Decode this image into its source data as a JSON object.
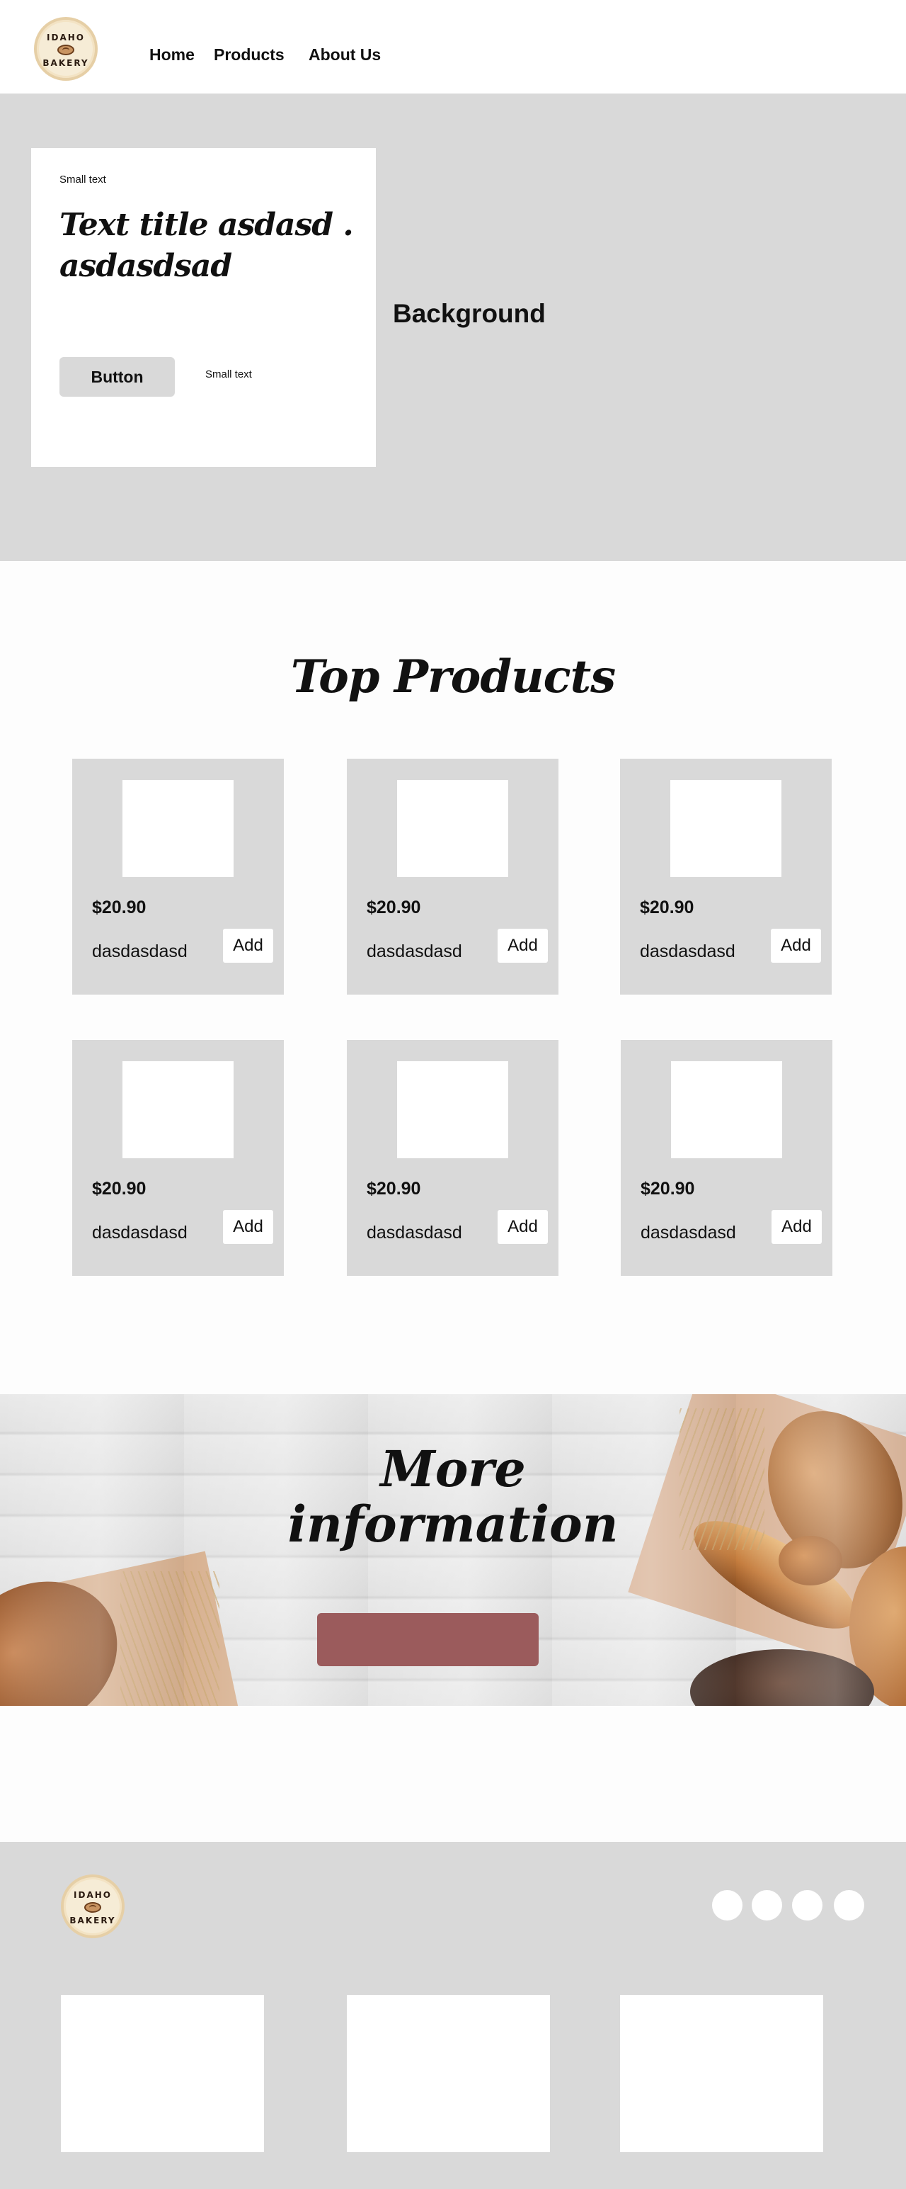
{
  "brand": {
    "logo_top_text": "IDAHO",
    "logo_bottom_text": "BAKERY"
  },
  "nav": {
    "items": [
      {
        "label": "Home"
      },
      {
        "label": "Products"
      },
      {
        "label": "About Us"
      }
    ]
  },
  "hero": {
    "small_text": "Small text",
    "title": "Text title asdasd . asdasdsad",
    "button_label": "Button",
    "button_small_text": "Small text",
    "background_label": "Background"
  },
  "products": {
    "title": "Top Products",
    "items": [
      {
        "price": "$20.90",
        "name": "dasdasdasd",
        "add_label": "Add"
      },
      {
        "price": "$20.90",
        "name": "dasdasdasd",
        "add_label": "Add"
      },
      {
        "price": "$20.90",
        "name": "dasdasdasd",
        "add_label": "Add"
      },
      {
        "price": "$20.90",
        "name": "dasdasdasd",
        "add_label": "Add"
      },
      {
        "price": "$20.90",
        "name": "dasdasdasd",
        "add_label": "Add"
      },
      {
        "price": "$20.90",
        "name": "dasdasdasd",
        "add_label": "Add"
      }
    ]
  },
  "more_info": {
    "title_line1": "More",
    "title_line2": "information",
    "button_label": "",
    "button_color": "#9b5b5c"
  },
  "footer": {
    "logo_top_text": "IDAHO",
    "logo_bottom_text": "BAKERY",
    "social_icons": [
      "social-icon-1",
      "social-icon-2",
      "social-icon-3",
      "social-icon-4"
    ]
  },
  "colors": {
    "section_gray": "#d9d9d9",
    "card_white": "#ffffff",
    "text": "#111111",
    "accent": "#9b5b5c"
  }
}
